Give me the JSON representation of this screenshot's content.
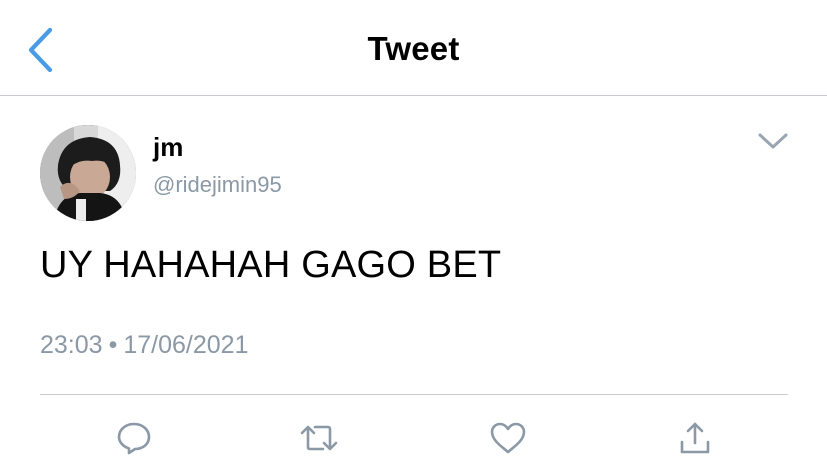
{
  "header": {
    "title": "Tweet",
    "back_icon": "chevron-left-icon",
    "accent_color": "#4a9be6"
  },
  "tweet": {
    "author": {
      "display_name": "jm",
      "handle": "@ridejimin95"
    },
    "text": "UY HAHAHAH GAGO BET",
    "time": "23:03",
    "separator": "•",
    "date": "17/06/2021",
    "menu_icon": "chevron-down-icon"
  },
  "actions": [
    {
      "name": "reply",
      "icon": "reply-icon"
    },
    {
      "name": "retweet",
      "icon": "retweet-icon"
    },
    {
      "name": "like",
      "icon": "heart-icon"
    },
    {
      "name": "share",
      "icon": "share-icon"
    }
  ],
  "colors": {
    "text": "#000000",
    "secondary_text": "#8b98a5",
    "divider": "#c9ccd0",
    "icon": "#8b98a5"
  }
}
